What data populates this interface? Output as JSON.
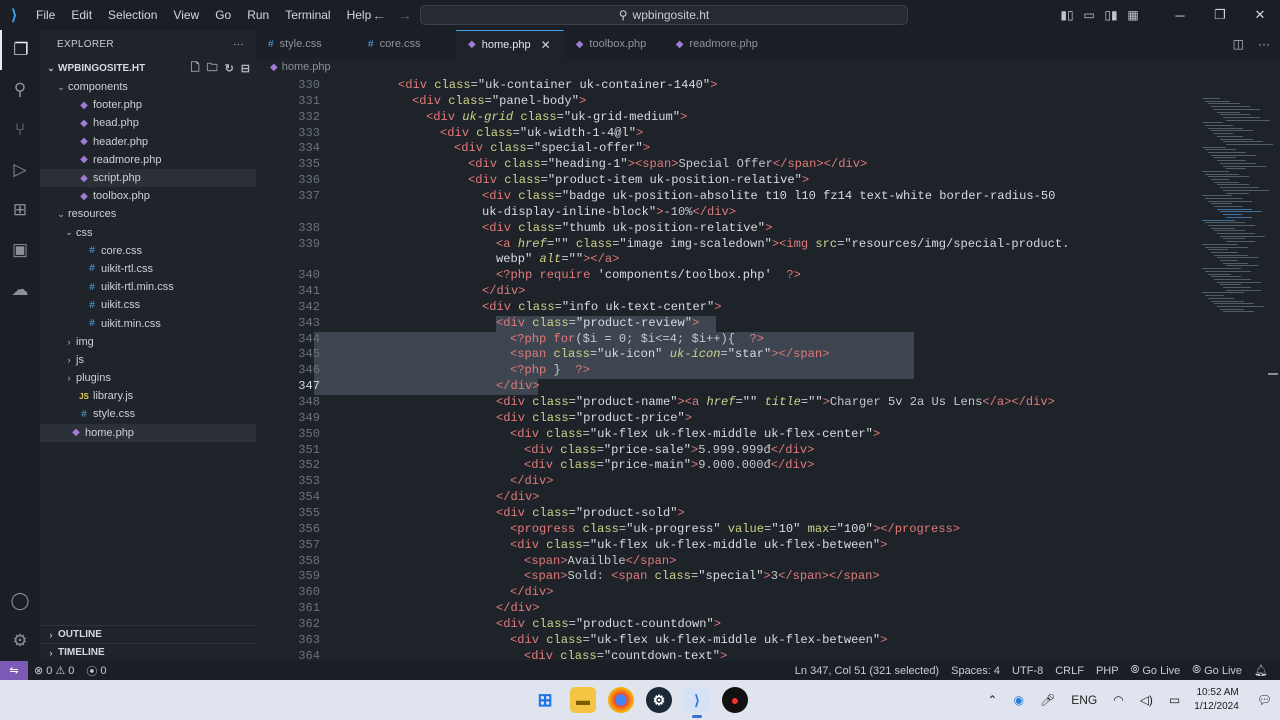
{
  "titlebar": {
    "menu": [
      "File",
      "Edit",
      "Selection",
      "View",
      "Go",
      "Run",
      "Terminal",
      "Help"
    ],
    "search_text": "wpbingosite.ht"
  },
  "sidebar": {
    "header": "EXPLORER",
    "workspace": "WPBINGOSITE.HT",
    "tree": [
      {
        "label": "components",
        "type": "folder",
        "depth": 0,
        "open": true
      },
      {
        "label": "footer.php",
        "type": "php",
        "depth": 1
      },
      {
        "label": "head.php",
        "type": "php",
        "depth": 1
      },
      {
        "label": "header.php",
        "type": "php",
        "depth": 1
      },
      {
        "label": "readmore.php",
        "type": "php",
        "depth": 1
      },
      {
        "label": "script.php",
        "type": "php",
        "depth": 1,
        "hover": true
      },
      {
        "label": "toolbox.php",
        "type": "php",
        "depth": 1
      },
      {
        "label": "resources",
        "type": "folder",
        "depth": 0,
        "open": true
      },
      {
        "label": "css",
        "type": "folder",
        "depth": 1,
        "open": true
      },
      {
        "label": "core.css",
        "type": "css",
        "depth": 2
      },
      {
        "label": "uikit-rtl.css",
        "type": "css",
        "depth": 2
      },
      {
        "label": "uikit-rtl.min.css",
        "type": "css",
        "depth": 2
      },
      {
        "label": "uikit.css",
        "type": "css",
        "depth": 2
      },
      {
        "label": "uikit.min.css",
        "type": "css",
        "depth": 2
      },
      {
        "label": "img",
        "type": "folder",
        "depth": 1,
        "open": false
      },
      {
        "label": "js",
        "type": "folder",
        "depth": 1,
        "open": false
      },
      {
        "label": "plugins",
        "type": "folder",
        "depth": 1,
        "open": false
      },
      {
        "label": "library.js",
        "type": "js",
        "depth": 1
      },
      {
        "label": "style.css",
        "type": "css",
        "depth": 1
      },
      {
        "label": "home.php",
        "type": "php",
        "depth": 0,
        "selected": true
      }
    ],
    "outline": "OUTLINE",
    "timeline": "TIMELINE"
  },
  "editor": {
    "tabs": [
      {
        "label": "style.css",
        "icon": "#",
        "active": false
      },
      {
        "label": "core.css",
        "icon": "#",
        "active": false
      },
      {
        "label": "home.php",
        "icon": "php-icon",
        "active": true
      },
      {
        "label": "toolbox.php",
        "icon": "php-icon",
        "active": false
      },
      {
        "label": "readmore.php",
        "icon": "php-icon",
        "active": false
      }
    ],
    "breadcrumb": "home.php",
    "current_line": 347,
    "lines": [
      {
        "n": 330,
        "indent": 8,
        "segs": [
          [
            "t",
            "<div "
          ],
          [
            "a",
            "class"
          ],
          [
            "c",
            "="
          ],
          [
            "s",
            "\"uk-container uk-container-1440\""
          ],
          [
            "t",
            ">"
          ]
        ]
      },
      {
        "n": 331,
        "indent": 10,
        "segs": [
          [
            "t",
            "<div "
          ],
          [
            "a",
            "class"
          ],
          [
            "c",
            "="
          ],
          [
            "s",
            "\"panel-body\""
          ],
          [
            "t",
            ">"
          ]
        ]
      },
      {
        "n": 332,
        "indent": 12,
        "segs": [
          [
            "t",
            "<div "
          ],
          [
            "ai",
            "uk-grid "
          ],
          [
            "a",
            "class"
          ],
          [
            "c",
            "="
          ],
          [
            "s",
            "\"uk-grid-medium\""
          ],
          [
            "t",
            ">"
          ]
        ]
      },
      {
        "n": 333,
        "indent": 14,
        "segs": [
          [
            "t",
            "<div "
          ],
          [
            "a",
            "class"
          ],
          [
            "c",
            "="
          ],
          [
            "s",
            "\"uk-width-1-4@l\""
          ],
          [
            "t",
            ">"
          ]
        ]
      },
      {
        "n": 334,
        "indent": 16,
        "segs": [
          [
            "t",
            "<div "
          ],
          [
            "a",
            "class"
          ],
          [
            "c",
            "="
          ],
          [
            "s",
            "\"special-offer\""
          ],
          [
            "t",
            ">"
          ]
        ]
      },
      {
        "n": 335,
        "indent": 18,
        "segs": [
          [
            "t",
            "<div "
          ],
          [
            "a",
            "class"
          ],
          [
            "c",
            "="
          ],
          [
            "s",
            "\"heading-1\""
          ],
          [
            "t",
            "><span>"
          ],
          [
            "c",
            "Special Offer"
          ],
          [
            "t",
            "</span></div>"
          ]
        ]
      },
      {
        "n": 336,
        "indent": 18,
        "segs": [
          [
            "t",
            "<div "
          ],
          [
            "a",
            "class"
          ],
          [
            "c",
            "="
          ],
          [
            "s",
            "\"product-item uk-position-relative\""
          ],
          [
            "t",
            ">"
          ]
        ]
      },
      {
        "n": 337,
        "indent": 20,
        "segs": [
          [
            "t",
            "<div "
          ],
          [
            "a",
            "class"
          ],
          [
            "c",
            "="
          ],
          [
            "s",
            "\"badge uk-position-absolite t10 l10 fz14 text-white border-radius-50"
          ]
        ]
      },
      {
        "n": null,
        "indent": 20,
        "segs": [
          [
            "s",
            "uk-display-inline-block\""
          ],
          [
            "t",
            ">"
          ],
          [
            "c",
            "-10%"
          ],
          [
            "t",
            "</div>"
          ]
        ]
      },
      {
        "n": 338,
        "indent": 20,
        "segs": [
          [
            "t",
            "<div "
          ],
          [
            "a",
            "class"
          ],
          [
            "c",
            "="
          ],
          [
            "s",
            "\"thumb uk-position-relative\""
          ],
          [
            "t",
            ">"
          ]
        ]
      },
      {
        "n": 339,
        "indent": 22,
        "segs": [
          [
            "t",
            "<a "
          ],
          [
            "ai",
            "href"
          ],
          [
            "c",
            "="
          ],
          [
            "s",
            "\"\" "
          ],
          [
            "a",
            "class"
          ],
          [
            "c",
            "="
          ],
          [
            "s",
            "\"image img-scaledown\""
          ],
          [
            "t",
            "><img "
          ],
          [
            "a",
            "src"
          ],
          [
            "c",
            "="
          ],
          [
            "s",
            "\"resources/img/special-product."
          ]
        ]
      },
      {
        "n": null,
        "indent": 22,
        "segs": [
          [
            "s",
            "webp\" "
          ],
          [
            "ai",
            "alt"
          ],
          [
            "c",
            "="
          ],
          [
            "s",
            "\"\""
          ],
          [
            "t",
            "></a>"
          ]
        ]
      },
      {
        "n": 340,
        "indent": 22,
        "segs": [
          [
            "p",
            "<?php "
          ],
          [
            "p",
            "require "
          ],
          [
            "s",
            "'components/toolbox.php'  "
          ],
          [
            "p",
            "?>"
          ]
        ]
      },
      {
        "n": 341,
        "indent": 20,
        "segs": [
          [
            "t",
            "</div>"
          ]
        ]
      },
      {
        "n": 342,
        "indent": 20,
        "segs": [
          [
            "t",
            "<div "
          ],
          [
            "a",
            "class"
          ],
          [
            "c",
            "="
          ],
          [
            "s",
            "\"info uk-text-center\""
          ],
          [
            "t",
            ">"
          ]
        ]
      },
      {
        "n": 343,
        "indent": 22,
        "segs": [
          [
            "t",
            "<div "
          ],
          [
            "a",
            "class"
          ],
          [
            "c",
            "="
          ],
          [
            "s",
            "\"product-review\""
          ],
          [
            "t",
            ">"
          ]
        ]
      },
      {
        "n": 344,
        "indent": 24,
        "segs": [
          [
            "p",
            "<?php "
          ],
          [
            "p",
            "for"
          ],
          [
            "c",
            "($i = 0; $i<=4; $i++){  "
          ],
          [
            "p",
            "?>"
          ]
        ]
      },
      {
        "n": 345,
        "indent": 24,
        "segs": [
          [
            "t",
            "<span "
          ],
          [
            "a",
            "class"
          ],
          [
            "c",
            "="
          ],
          [
            "s",
            "\"uk-icon\" "
          ],
          [
            "ai",
            "uk-icon"
          ],
          [
            "c",
            "="
          ],
          [
            "s",
            "\"star\""
          ],
          [
            "t",
            "></span>"
          ]
        ]
      },
      {
        "n": 346,
        "indent": 24,
        "segs": [
          [
            "p",
            "<?php "
          ],
          [
            "c",
            "}  "
          ],
          [
            "p",
            "?>"
          ]
        ]
      },
      {
        "n": 347,
        "indent": 22,
        "segs": [
          [
            "t",
            "</div>"
          ]
        ]
      },
      {
        "n": 348,
        "indent": 22,
        "segs": [
          [
            "t",
            "<div "
          ],
          [
            "a",
            "class"
          ],
          [
            "c",
            "="
          ],
          [
            "s",
            "\"product-name\""
          ],
          [
            "t",
            "><a "
          ],
          [
            "ai",
            "href"
          ],
          [
            "c",
            "="
          ],
          [
            "s",
            "\"\" "
          ],
          [
            "ai",
            "title"
          ],
          [
            "c",
            "="
          ],
          [
            "s",
            "\"\""
          ],
          [
            "t",
            ">"
          ],
          [
            "c",
            "Charger 5v 2a Us Lens"
          ],
          [
            "t",
            "</a></div>"
          ]
        ]
      },
      {
        "n": 349,
        "indent": 22,
        "segs": [
          [
            "t",
            "<div "
          ],
          [
            "a",
            "class"
          ],
          [
            "c",
            "="
          ],
          [
            "s",
            "\"product-price\""
          ],
          [
            "t",
            ">"
          ]
        ]
      },
      {
        "n": 350,
        "indent": 24,
        "segs": [
          [
            "t",
            "<div "
          ],
          [
            "a",
            "class"
          ],
          [
            "c",
            "="
          ],
          [
            "s",
            "\"uk-flex uk-flex-middle uk-flex-center\""
          ],
          [
            "t",
            ">"
          ]
        ]
      },
      {
        "n": 351,
        "indent": 26,
        "segs": [
          [
            "t",
            "<div "
          ],
          [
            "a",
            "class"
          ],
          [
            "c",
            "="
          ],
          [
            "s",
            "\"price-sale\""
          ],
          [
            "t",
            ">"
          ],
          [
            "c",
            "5.999.999đ"
          ],
          [
            "t",
            "</div>"
          ]
        ]
      },
      {
        "n": 352,
        "indent": 26,
        "segs": [
          [
            "t",
            "<div "
          ],
          [
            "a",
            "class"
          ],
          [
            "c",
            "="
          ],
          [
            "s",
            "\"price-main\""
          ],
          [
            "t",
            ">"
          ],
          [
            "c",
            "9.000.000đ"
          ],
          [
            "t",
            "</div>"
          ]
        ]
      },
      {
        "n": 353,
        "indent": 24,
        "segs": [
          [
            "t",
            "</div>"
          ]
        ]
      },
      {
        "n": 354,
        "indent": 22,
        "segs": [
          [
            "t",
            "</div>"
          ]
        ]
      },
      {
        "n": 355,
        "indent": 22,
        "segs": [
          [
            "t",
            "<div "
          ],
          [
            "a",
            "class"
          ],
          [
            "c",
            "="
          ],
          [
            "s",
            "\"product-sold\""
          ],
          [
            "t",
            ">"
          ]
        ]
      },
      {
        "n": 356,
        "indent": 24,
        "segs": [
          [
            "t",
            "<progress "
          ],
          [
            "a",
            "class"
          ],
          [
            "c",
            "="
          ],
          [
            "s",
            "\"uk-progress\" "
          ],
          [
            "a",
            "value"
          ],
          [
            "c",
            "="
          ],
          [
            "s",
            "\"10\" "
          ],
          [
            "a",
            "max"
          ],
          [
            "c",
            "="
          ],
          [
            "s",
            "\"100\""
          ],
          [
            "t",
            "></progress>"
          ]
        ]
      },
      {
        "n": 357,
        "indent": 24,
        "segs": [
          [
            "t",
            "<div "
          ],
          [
            "a",
            "class"
          ],
          [
            "c",
            "="
          ],
          [
            "s",
            "\"uk-flex uk-flex-middle uk-flex-between\""
          ],
          [
            "t",
            ">"
          ]
        ]
      },
      {
        "n": 358,
        "indent": 26,
        "segs": [
          [
            "t",
            "<span>"
          ],
          [
            "c",
            "Availble"
          ],
          [
            "t",
            "</span>"
          ]
        ]
      },
      {
        "n": 359,
        "indent": 26,
        "segs": [
          [
            "t",
            "<span>"
          ],
          [
            "c",
            "Sold: "
          ],
          [
            "t",
            "<span "
          ],
          [
            "a",
            "class"
          ],
          [
            "c",
            "="
          ],
          [
            "s",
            "\"special\""
          ],
          [
            "t",
            ">"
          ],
          [
            "c",
            "3"
          ],
          [
            "t",
            "</span></span>"
          ]
        ]
      },
      {
        "n": 360,
        "indent": 24,
        "segs": [
          [
            "t",
            "</div>"
          ]
        ]
      },
      {
        "n": 361,
        "indent": 22,
        "segs": [
          [
            "t",
            "</div>"
          ]
        ]
      },
      {
        "n": 362,
        "indent": 22,
        "segs": [
          [
            "t",
            "<div "
          ],
          [
            "a",
            "class"
          ],
          [
            "c",
            "="
          ],
          [
            "s",
            "\"product-countdown\""
          ],
          [
            "t",
            ">"
          ]
        ]
      },
      {
        "n": 363,
        "indent": 24,
        "segs": [
          [
            "t",
            "<div "
          ],
          [
            "a",
            "class"
          ],
          [
            "c",
            "="
          ],
          [
            "s",
            "\"uk-flex uk-flex-middle uk-flex-between\""
          ],
          [
            "t",
            ">"
          ]
        ]
      },
      {
        "n": 364,
        "indent": 26,
        "segs": [
          [
            "t",
            "<div "
          ],
          [
            "a",
            "class"
          ],
          [
            "c",
            "="
          ],
          [
            "s",
            "\"countdown-text\""
          ],
          [
            "t",
            ">"
          ]
        ]
      }
    ]
  },
  "statusbar": {
    "errors": "0",
    "warnings": "0",
    "ports": "0",
    "position": "Ln 347, Col 51 (321 selected)",
    "spaces": "Spaces: 4",
    "encoding": "UTF-8",
    "eol": "CRLF",
    "language": "PHP",
    "golive1": "Go Live",
    "golive2": "Go Live"
  },
  "taskbar": {
    "language": "ENG",
    "time": "10:52 AM",
    "date": "1/12/2024"
  },
  "colors": {
    "accent": "#3ea6f2",
    "tag": "#e07a7a",
    "attribute": "#cfd28a",
    "remote": "#7b5ab5"
  }
}
